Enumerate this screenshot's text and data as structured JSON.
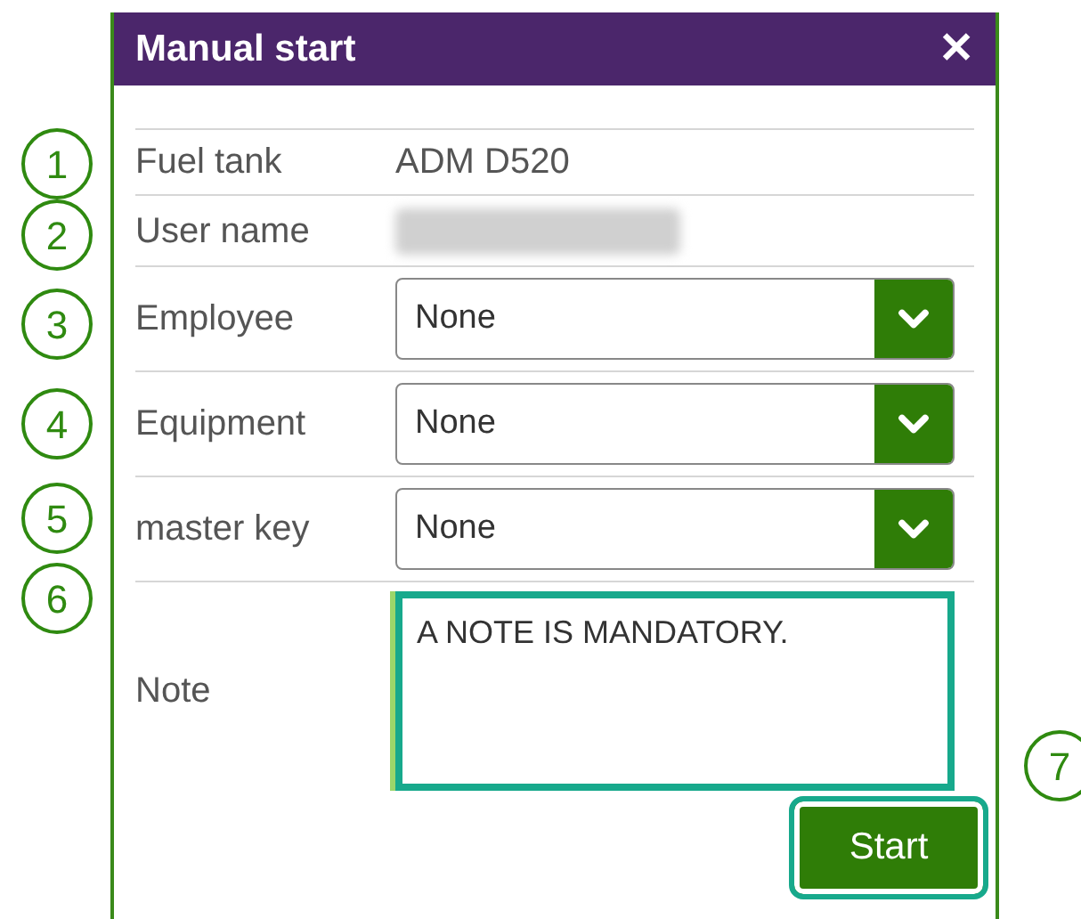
{
  "dialog": {
    "title": "Manual start",
    "close": "✕",
    "rows": [
      {
        "kind": "text",
        "label": "Fuel tank",
        "value": "ADM D520"
      },
      {
        "kind": "blurred",
        "label": "User name"
      },
      {
        "kind": "select",
        "label": "Employee",
        "value": "None"
      },
      {
        "kind": "select",
        "label": "Equipment",
        "value": "None"
      },
      {
        "kind": "select",
        "label": "master key",
        "value": "None"
      },
      {
        "kind": "note",
        "label": "Note",
        "value": "A NOTE IS MANDATORY."
      }
    ],
    "button": "Start"
  },
  "callouts": [
    "1",
    "2",
    "3",
    "4",
    "5",
    "6",
    "7"
  ]
}
